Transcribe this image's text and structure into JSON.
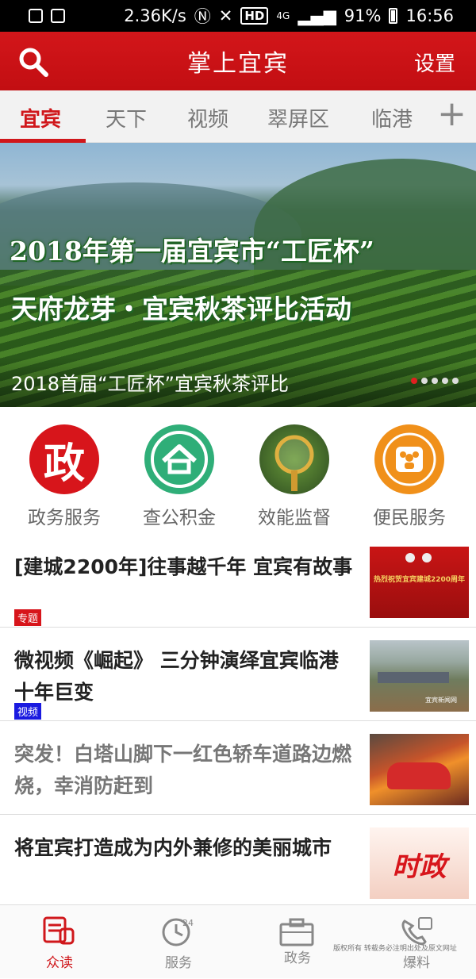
{
  "status_bar": {
    "speed": "2.36K/s",
    "hd": "HD",
    "network": "4G",
    "battery": "91%",
    "time": "16:56"
  },
  "header": {
    "title": "掌上宜宾",
    "settings_label": "设置"
  },
  "tabs": [
    "宜宾",
    "天下",
    "视频",
    "翠屏区",
    "临港"
  ],
  "tab_add": "+",
  "banner": {
    "headline_line1": "2018年第一届宜宾市“工匠杯”",
    "headline_line2": "天府龙芽・宜宾秋茶评比活动",
    "caption": "2018首届“工匠杯”宜宾秋茶评比",
    "slide_count": 5,
    "active_slide": 1
  },
  "services": [
    {
      "label": "政务服务",
      "icon": "zheng-icon",
      "color": "#d7151b"
    },
    {
      "label": "查公积金",
      "icon": "house-icon",
      "color": "#2fae78"
    },
    {
      "label": "效能监督",
      "icon": "magnifier-icon",
      "color": "#3d7a3a"
    },
    {
      "label": "便民服务",
      "icon": "people-icon",
      "color": "#f0901a"
    }
  ],
  "service_zheng_char": "政",
  "news": [
    {
      "title": "[建城2200年]往事越千年 宜宾有故事",
      "tag": "专题",
      "tag_color": "#d7151b",
      "read": false,
      "thumb_text": "热烈祝贺宜宾建城2200周年"
    },
    {
      "title": "微视频《崛起》 三分钟演绎宜宾临港十年巨变",
      "tag": "视频",
      "tag_color": "#1a1ae0",
      "read": false,
      "thumb_text": "宜宾新闻网"
    },
    {
      "title": "突发！白塔山脚下一红色轿车道路边燃烧，幸消防赶到",
      "tag": "",
      "tag_color": "",
      "read": true,
      "thumb_text": ""
    },
    {
      "title": "将宜宾打造成为内外兼修的美丽城市",
      "tag": "",
      "tag_color": "",
      "read": false,
      "thumb_text": "时政"
    }
  ],
  "bottom_nav": [
    {
      "label": "众读",
      "icon": "reader-icon",
      "active": true
    },
    {
      "label": "服务",
      "icon": "clock-24-icon",
      "active": false
    },
    {
      "label": "政务",
      "icon": "briefcase-icon",
      "active": false
    },
    {
      "label": "爆料",
      "icon": "phone-icon",
      "active": false
    }
  ],
  "watermark": "版权所有   转载务必注明出处及原文网址",
  "colors": {
    "brand_red": "#d0171b",
    "tab_bg": "#f2f2f2"
  }
}
